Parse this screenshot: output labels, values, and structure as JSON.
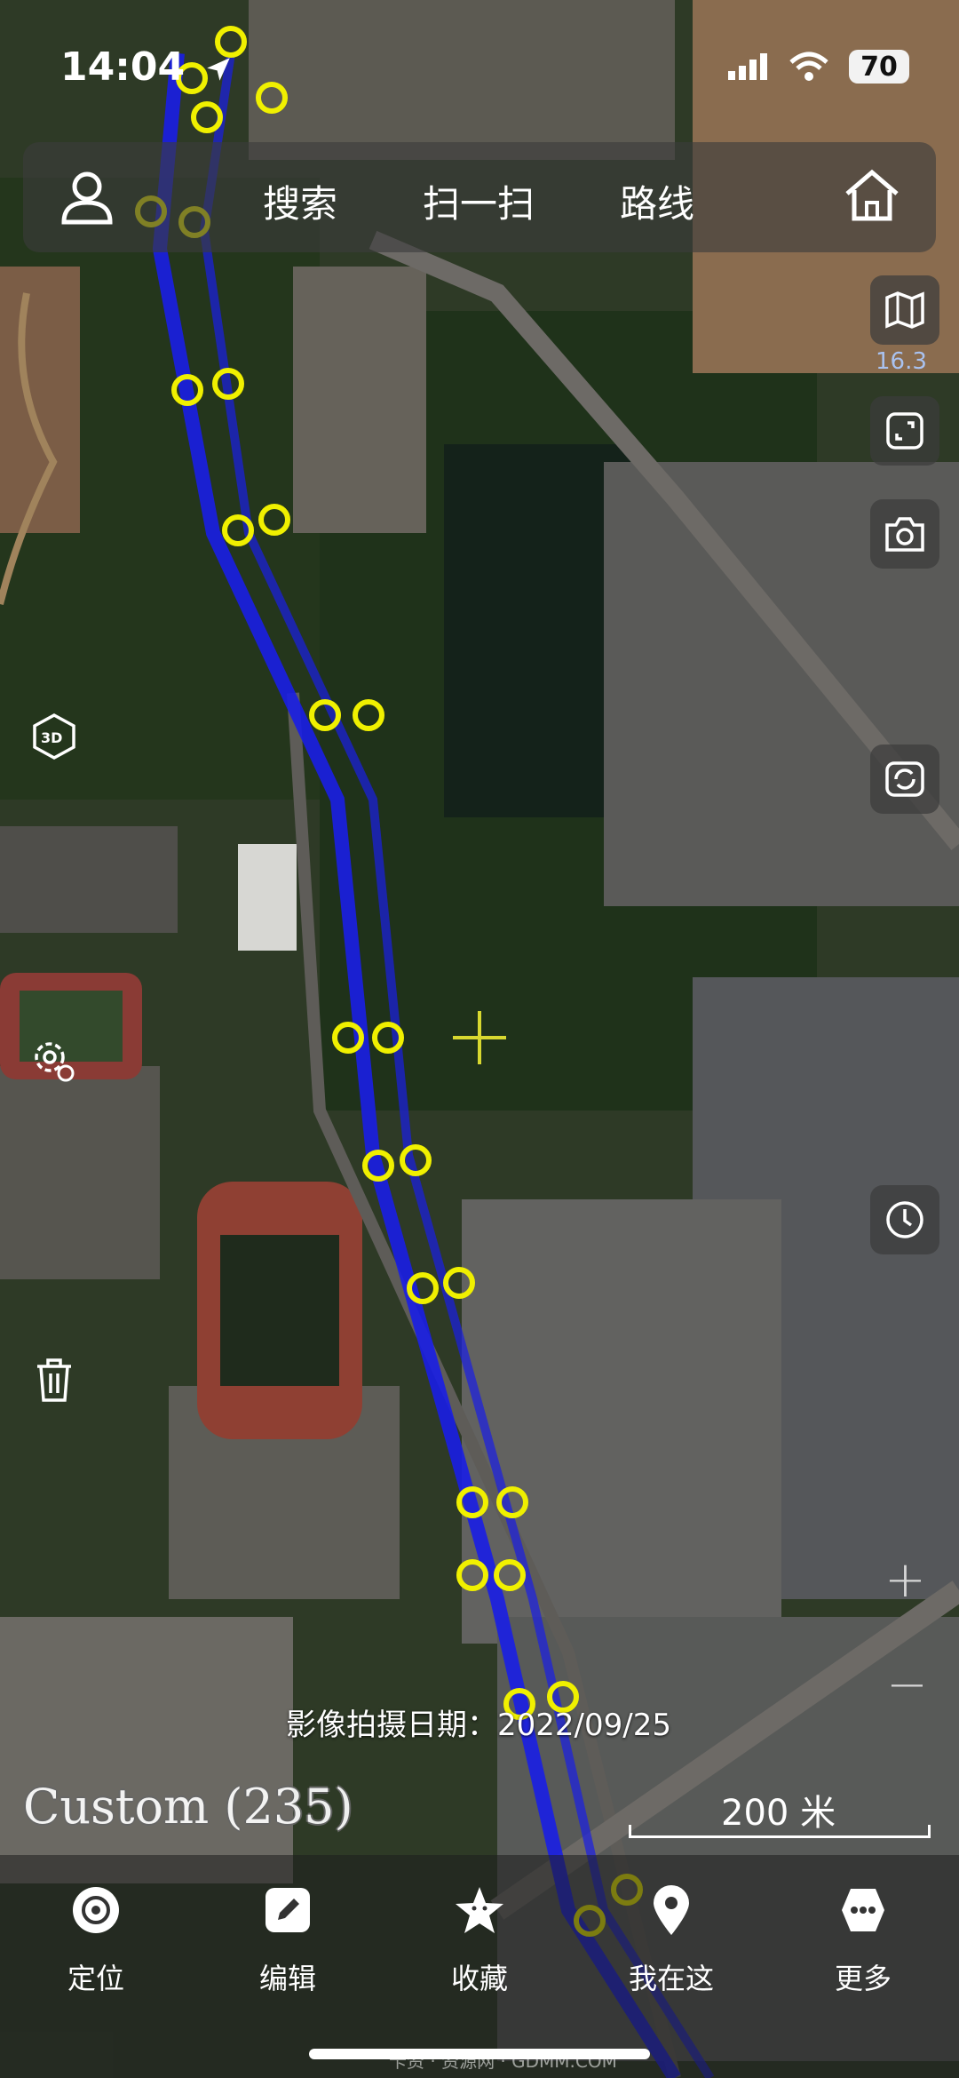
{
  "status": {
    "time": "14:04",
    "battery": "70"
  },
  "topbar": {
    "tabs": [
      "搜索",
      "扫一扫",
      "路线"
    ]
  },
  "map": {
    "zoom_level": "16.3",
    "capture_date": "影像拍摄日期：2022/09/25",
    "layer_name": "Custom (235)",
    "scale": "200 米",
    "zoom_in": "+",
    "zoom_out": "−"
  },
  "bottom_nav": {
    "items": [
      "定位",
      "编辑",
      "收藏",
      "我在这",
      "更多"
    ]
  },
  "watermark": "卡资 · 资源网 · GDMM.COM",
  "colors": {
    "route": "#1a1ee6",
    "waypoint": "#f0f000",
    "accent_label": "#a9c2f0"
  }
}
